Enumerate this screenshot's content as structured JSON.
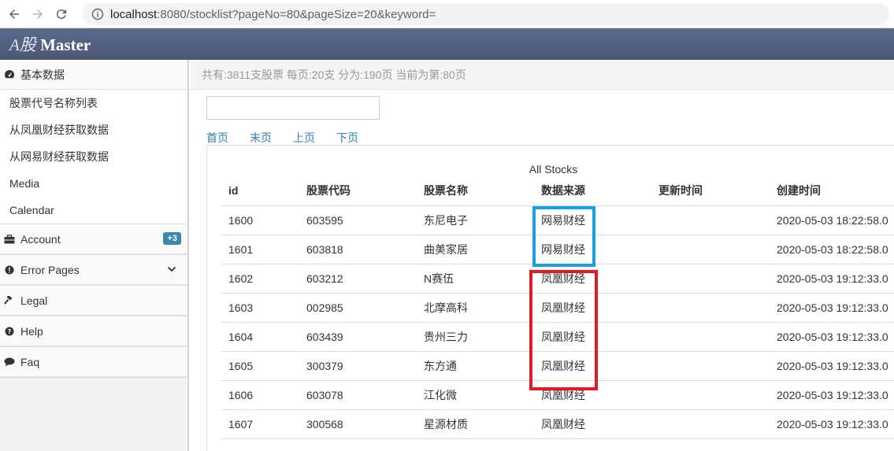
{
  "browser": {
    "url_host": "localhost",
    "url_path": ":8080/stocklist?pageNo=80&pageSize=20&keyword="
  },
  "app": {
    "brand_italic": "A股",
    "brand_bold": "Master"
  },
  "sidebar": {
    "groups": [
      {
        "label": "基本数据",
        "icon": "dashboard-icon",
        "items": [
          "股票代号名称列表",
          "从凤凰财经获取数据",
          "从网易财经获取数据",
          "Media",
          "Calendar"
        ]
      },
      {
        "label": "Account",
        "icon": "briefcase-icon",
        "badge": "+3"
      },
      {
        "label": "Error Pages",
        "icon": "warning-icon"
      },
      {
        "label": "Legal",
        "icon": "gavel-icon"
      },
      {
        "label": "Help",
        "icon": "question-icon"
      },
      {
        "label": "Faq",
        "icon": "comment-icon"
      }
    ]
  },
  "main": {
    "info": "共有:3811支股票 每页:20支 分为:190页 当前为第:80页",
    "search_value": "",
    "pager": [
      "首页",
      "末页",
      "上页",
      "下页"
    ],
    "table": {
      "caption": "All Stocks",
      "headers": [
        "id",
        "股票代码",
        "股票名称",
        "数据来源",
        "更新时间",
        "创建时间"
      ],
      "rows": [
        [
          "1600",
          "603595",
          "东尼电子",
          "网易财经",
          "",
          "2020-05-03 18:22:58.0"
        ],
        [
          "1601",
          "603818",
          "曲美家居",
          "网易财经",
          "",
          "2020-05-03 18:22:58.0"
        ],
        [
          "1602",
          "603212",
          "N赛伍",
          "凤凰财经",
          "",
          "2020-05-03 19:12:33.0"
        ],
        [
          "1603",
          "002985",
          "北摩高科",
          "凤凰财经",
          "",
          "2020-05-03 19:12:33.0"
        ],
        [
          "1604",
          "603439",
          "贵州三力",
          "凤凰财经",
          "",
          "2020-05-03 19:12:33.0"
        ],
        [
          "1605",
          "300379",
          "东方通",
          "凤凰财经",
          "",
          "2020-05-03 19:12:33.0"
        ],
        [
          "1606",
          "603078",
          "江化微",
          "凤凰财经",
          "",
          "2020-05-03 19:12:33.0"
        ],
        [
          "1607",
          "300568",
          "星源材质",
          "凤凰财经",
          "",
          "2020-05-03 19:12:33.0"
        ]
      ]
    }
  },
  "colors": {
    "highlight_blue": "#1a9fe0",
    "highlight_red": "#e01b24",
    "link": "#2a7fb8",
    "header_bg": "#4f5d7b"
  }
}
